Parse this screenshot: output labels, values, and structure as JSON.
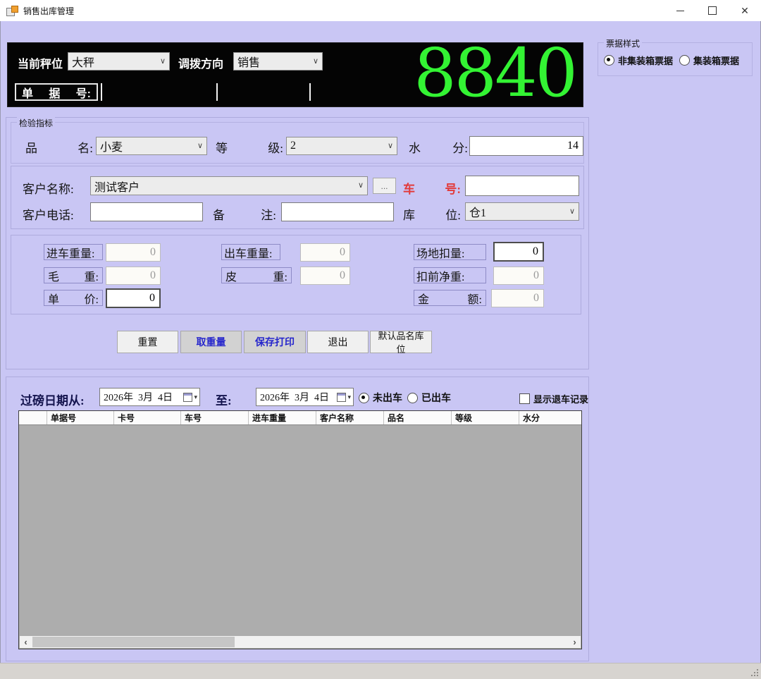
{
  "window": {
    "title": "销售出库管理"
  },
  "icons": {
    "chevron_down": "∨",
    "close": "✕",
    "dropdown_arrow": "▾",
    "scroll_left": "‹",
    "scroll_right": "›"
  },
  "display": {
    "scale_label": "当前秤位",
    "scale_value": "大秤",
    "direction_label": "调拨方向",
    "direction_value": "销售",
    "weight": "8840",
    "doc_label_parts": [
      "单",
      "据",
      "号:"
    ]
  },
  "ticket": {
    "title": "票据样式",
    "option_non_container": "非集装箱票据",
    "option_container": "集装箱票据"
  },
  "inspection": {
    "title": "检验指标",
    "product_label": [
      "品",
      "名:"
    ],
    "product_value": "小麦",
    "grade_label": [
      "等",
      "级:"
    ],
    "grade_value": "2",
    "moisture_label": [
      "水",
      "分:"
    ],
    "moisture_value": "14"
  },
  "customer": {
    "name_label": "客户名称:",
    "name_value": "测试客户",
    "browse_label": "...",
    "vehicle_label": [
      "车",
      "号:"
    ],
    "vehicle_value": "",
    "phone_label": "客户电话:",
    "phone_value": "",
    "remark_label": [
      "备",
      "注:"
    ],
    "remark_value": "",
    "warehouse_label": [
      "库",
      "位:"
    ],
    "warehouse_value": "仓1"
  },
  "weights": {
    "in_weight": {
      "label": "进车重量:",
      "value": "0"
    },
    "out_weight": {
      "label": "出车重量:",
      "value": "0"
    },
    "site_deduction": {
      "label": "场地扣量:",
      "value": "0"
    },
    "gross": {
      "label": [
        "毛",
        "重:"
      ],
      "value": "0"
    },
    "tare": {
      "label": [
        "皮",
        "重:"
      ],
      "value": "0"
    },
    "pre_net": {
      "label": "扣前净重:",
      "value": "0"
    },
    "unit_price": {
      "label": [
        "单",
        "价:"
      ],
      "value": "0"
    },
    "amount": {
      "label": [
        "金",
        "额:"
      ],
      "value": "0"
    }
  },
  "buttons": {
    "reset": "重置",
    "weigh": "取重量",
    "save_print": "保存打印",
    "exit": "退出",
    "default_product": "默认品名库位"
  },
  "filter": {
    "from_label": "过磅日期从:",
    "from_value": "2026年  3月  4日",
    "to_label": "至:",
    "to_value": "2026年  3月  4日",
    "not_departed": "未出车",
    "departed": "已出车",
    "show_returns": "显示退车记录"
  },
  "grid": {
    "columns": [
      "单据号",
      "卡号",
      "车号",
      "进车重量",
      "客户名称",
      "品名",
      "等级",
      "水分"
    ]
  },
  "colors": {
    "background": "#c9c6f4",
    "display_green": "#33f333",
    "vehicle_label_red": "#e23b3b",
    "button_text_blue": "#2626cc"
  }
}
